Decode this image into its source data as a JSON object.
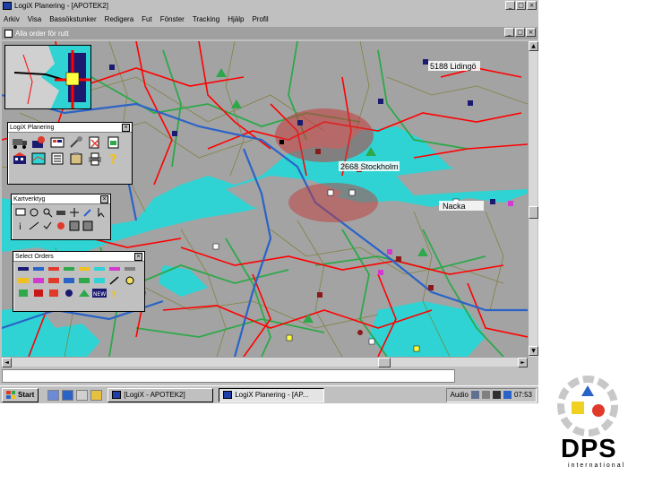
{
  "window": {
    "title": "LogiX Planering - [APOTEK2]",
    "controls": [
      "_",
      "□",
      "×"
    ]
  },
  "menu": [
    "Arkiv",
    "Visa",
    "Bassökstunker",
    "Redigera",
    "Fut",
    "Fönster",
    "Tracking",
    "Hjälp",
    "Profil"
  ],
  "child_window": {
    "title": "Alla order för rutt",
    "controls": [
      "_",
      "□",
      "×"
    ]
  },
  "map": {
    "labels": {
      "lidingo": "5188 Lidingö",
      "stockholm": "2668 Stockholm",
      "nacka": "Nacka"
    },
    "colors": {
      "water": "#2fd3d3",
      "land": "#a3a3a3",
      "major_road": "#ff0000",
      "highway": "#2a63c8",
      "green_road": "#2ea84a",
      "minor_road": "#7a7a2a"
    }
  },
  "toolwindows": {
    "planering": {
      "title": "LogiX Planering",
      "close": "×"
    },
    "kartverktyg": {
      "title": "Kartverktyg",
      "close": "×"
    },
    "select_orders": {
      "title": "Select Orders",
      "close": "×",
      "new_label": "NEW"
    }
  },
  "taskbar": {
    "start": "Start",
    "tasks": [
      "[LogiX - APOTEK2]",
      "LogiX Planering - [AP..."
    ],
    "clock": "07:53",
    "tray_text": "Audio"
  },
  "slide": {
    "brand": "DPS",
    "brand_sub": "international"
  }
}
